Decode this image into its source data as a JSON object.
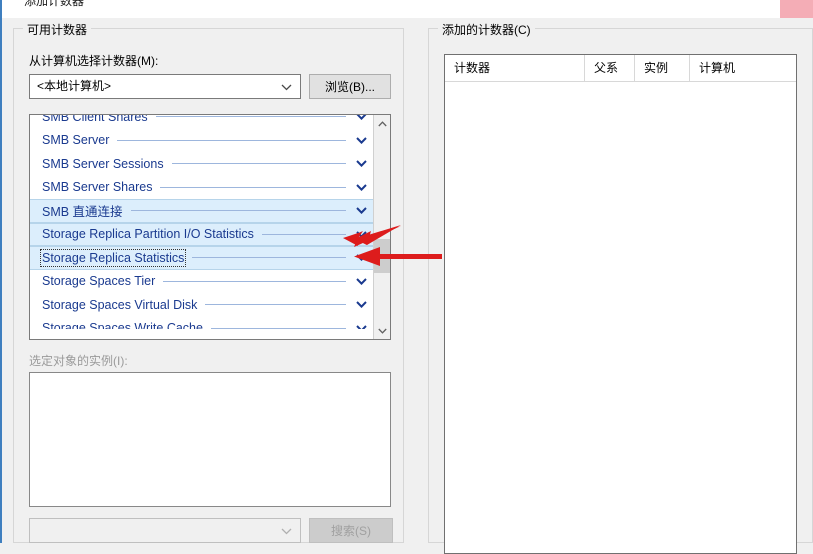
{
  "window": {
    "title": "添加计数器",
    "close_label": "✕"
  },
  "available_group": {
    "title": "可用计数器",
    "select_from_label": "从计算机选择计数器(M):",
    "computer_combo_value": "<本地计算机>",
    "browse_button": "浏览(B)...",
    "instances_label": "选定对象的实例(I):",
    "instance_filter_value": "",
    "search_button": "搜索(S)",
    "counters": [
      {
        "name": "SMB Client Shares",
        "selected": false,
        "focused": false,
        "clipped_top": true
      },
      {
        "name": "SMB Server",
        "selected": false,
        "focused": false
      },
      {
        "name": "SMB Server Sessions",
        "selected": false,
        "focused": false
      },
      {
        "name": "SMB Server Shares",
        "selected": false,
        "focused": false
      },
      {
        "name": "SMB 直通连接",
        "selected": true,
        "focused": false
      },
      {
        "name": "Storage Replica Partition I/O Statistics",
        "selected": true,
        "focused": false
      },
      {
        "name": "Storage Replica Statistics",
        "selected": true,
        "focused": true
      },
      {
        "name": "Storage Spaces Tier",
        "selected": false,
        "focused": false
      },
      {
        "name": "Storage Spaces Virtual Disk",
        "selected": false,
        "focused": false
      },
      {
        "name": "Storage Spaces Write Cache",
        "selected": false,
        "focused": false,
        "clipped_bottom": true
      }
    ],
    "instances": []
  },
  "added_group": {
    "title": "添加的计数器(C)",
    "columns": [
      "计数器",
      "父系",
      "实例",
      "计算机"
    ],
    "rows": []
  },
  "annotations": {
    "arrow_color": "#e01b1b",
    "arrow_count": 2
  },
  "colors": {
    "selection_background": "#dceefc",
    "counter_text": "#1a3a8f",
    "window_accent": "#3f7fbf",
    "close_hover": "#f4adb6",
    "dialog_background": "#f0f0f0"
  }
}
